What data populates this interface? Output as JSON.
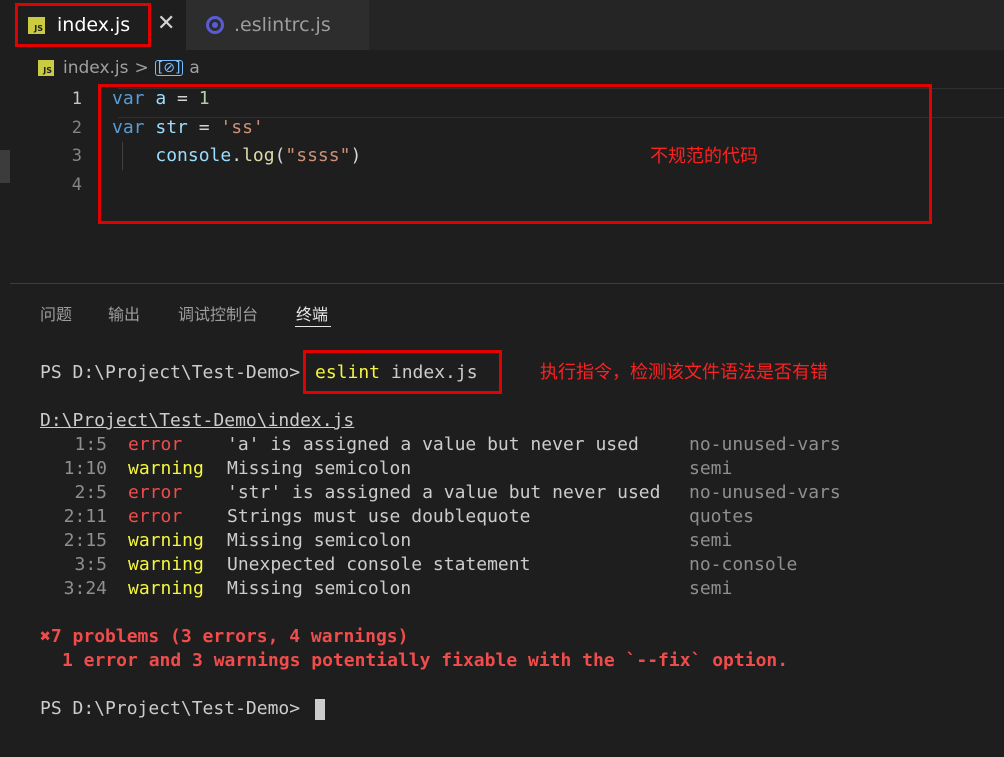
{
  "tabs": [
    {
      "label": "index.js",
      "icon": "js-file-icon",
      "active": true
    },
    {
      "label": ".eslintrc.js",
      "icon": "eslint-icon",
      "active": false
    }
  ],
  "close_glyph": "✕",
  "breadcrumb": {
    "file": "index.js",
    "separator": ">",
    "symbol_icon": "[⊘]",
    "symbol": "a"
  },
  "editor": {
    "line_numbers": [
      "1",
      "2",
      "3",
      "4"
    ],
    "lines": [
      [
        {
          "t": "var",
          "c": "kw"
        },
        {
          "t": " ",
          "c": "op"
        },
        {
          "t": "a",
          "c": "id"
        },
        {
          "t": " = ",
          "c": "op"
        },
        {
          "t": "1",
          "c": "num"
        }
      ],
      [
        {
          "t": "var",
          "c": "kw"
        },
        {
          "t": " ",
          "c": "op"
        },
        {
          "t": "str",
          "c": "id"
        },
        {
          "t": " = ",
          "c": "op"
        },
        {
          "t": "'ss'",
          "c": "str"
        }
      ],
      [
        {
          "t": "    ",
          "c": "op"
        },
        {
          "t": "console",
          "c": "id"
        },
        {
          "t": ".",
          "c": "op"
        },
        {
          "t": "log",
          "c": "fn"
        },
        {
          "t": "(",
          "c": "op"
        },
        {
          "t": "\"ssss\"",
          "c": "str"
        },
        {
          "t": ")",
          "c": "op"
        }
      ],
      []
    ]
  },
  "annotations": {
    "code": "不规范的代码",
    "command": "执行指令，检测该文件语法是否有错"
  },
  "panel": {
    "tabs": [
      "问题",
      "输出",
      "调试控制台",
      "终端"
    ],
    "active_tab": "终端"
  },
  "terminal": {
    "prompt": "PS D:\\Project\\Test-Demo>",
    "command": "eslint index.js",
    "file_path": "D:\\Project\\Test-Demo\\index.js",
    "problems": [
      {
        "loc": "1:5",
        "severity": "error",
        "message": "'a' is assigned a value but never used",
        "rule": "no-unused-vars"
      },
      {
        "loc": "1:10",
        "severity": "warning",
        "message": "Missing semicolon",
        "rule": "semi"
      },
      {
        "loc": "2:5",
        "severity": "error",
        "message": "'str' is assigned a value but never used",
        "rule": "no-unused-vars"
      },
      {
        "loc": "2:11",
        "severity": "error",
        "message": "Strings must use doublequote",
        "rule": "quotes"
      },
      {
        "loc": "2:15",
        "severity": "warning",
        "message": "Missing semicolon",
        "rule": "semi"
      },
      {
        "loc": "3:5",
        "severity": "warning",
        "message": "Unexpected console statement",
        "rule": "no-console"
      },
      {
        "loc": "3:24",
        "severity": "warning",
        "message": "Missing semicolon",
        "rule": "semi"
      }
    ],
    "summary_icon": "✖",
    "summary": "7 problems (3 errors, 4 warnings)",
    "fixable": "1 error and 3 warnings potentially fixable with the `--fix` option.",
    "final_prompt": "PS D:\\Project\\Test-Demo>"
  },
  "colors": {
    "error": "#f14c4c",
    "warning": "#f5f543",
    "annotation": "#e30000"
  }
}
